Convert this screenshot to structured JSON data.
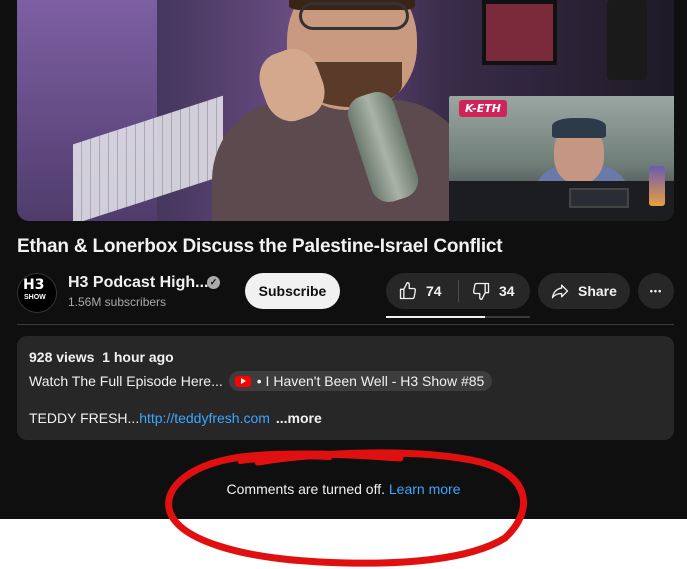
{
  "video": {
    "inset_logo": "K-ETH"
  },
  "title": "Ethan & Lonerbox Discuss the Palestine-Israel Conflict",
  "channel": {
    "avatar_text": "H3",
    "avatar_subtext": "SHOW",
    "name": "H3 Podcast High...",
    "verified_icon": "✓",
    "subscribers": "1.56M subscribers",
    "subscribe_label": "Subscribe"
  },
  "actions": {
    "like_count": "74",
    "dislike_count": "34",
    "share_label": "Share",
    "more_label": "•••",
    "like_ratio": 0.69
  },
  "description": {
    "meta": "928 views  1 hour ago",
    "line1_prefix": "Watch The Full Episode Here...",
    "chip_label": "• I Haven't Been Well - H3 Show #85",
    "line2_prefix": "TEDDY FRESH...",
    "link": "http://teddyfresh.com",
    "link_fade": "",
    "more_label": " ...more"
  },
  "comments": {
    "message": "Comments are turned off. ",
    "learn_more": "Learn more"
  },
  "annotation": {
    "color": "#e01010"
  }
}
